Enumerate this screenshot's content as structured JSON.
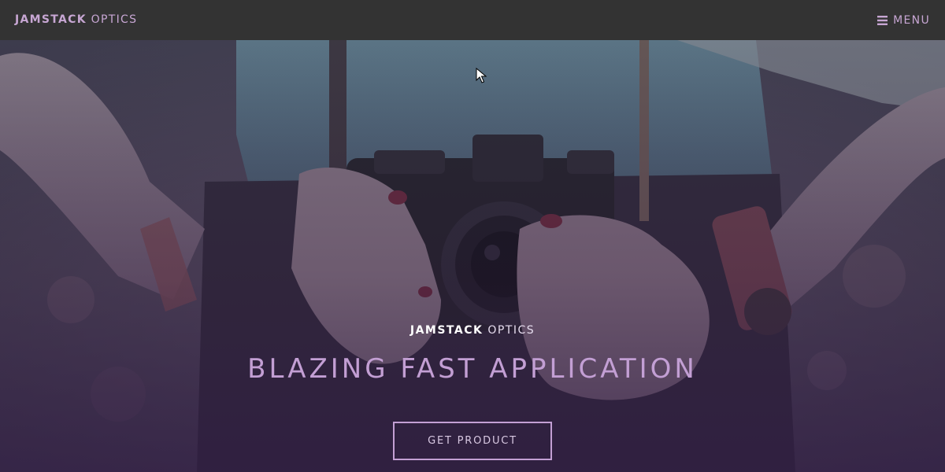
{
  "navbar": {
    "brand_bold": "JAMSTACK",
    "brand_light": "OPTICS",
    "menu_label": "MENU",
    "menu_icon": "hamburger-icon"
  },
  "hero": {
    "brand_bold": "JAMSTACK",
    "brand_light": "OPTICS",
    "title": "BLAZING FAST APPLICATION",
    "cta_label": "GET PRODUCT",
    "background_image": "woman-holding-camera-photo"
  },
  "colors": {
    "navbar_bg": "#333333",
    "accent": "#c39fd4",
    "overlay": "#3a2447"
  }
}
